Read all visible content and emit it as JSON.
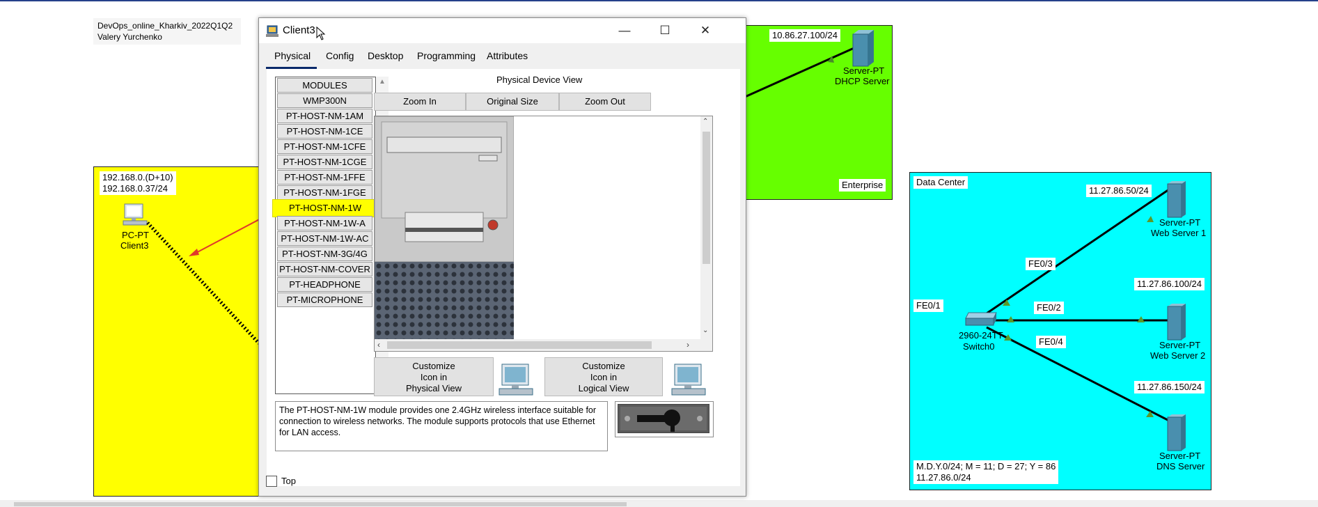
{
  "canvas": {
    "header_note": [
      "DevOps_online_Kharkiv_2022Q1Q2",
      "Valery Yurchenko"
    ],
    "yellow_zone": {
      "color": "#ffff00",
      "networks": [
        "192.168.0.(D+10)",
        "192.168.0.37/24"
      ],
      "device_type": "PC-PT",
      "device_name": "Client3"
    },
    "green_zone": {
      "color": "#66ff00",
      "ip": "10.86.27.100/24",
      "device_type": "Server-PT",
      "device_name": "DHCP Server",
      "zone_label": "Enterprise"
    },
    "cyan_zone": {
      "color": "#00ffff",
      "label": "Data Center",
      "port_fe01": "FE0/1",
      "ports": [
        "FE0/3",
        "FE0/2",
        "FE0/4"
      ],
      "switch_model": "2960-24TT",
      "switch_name": "Switch0",
      "servers": [
        {
          "ip": "11.27.86.50/24",
          "type": "Server-PT",
          "name": "Web Server 1"
        },
        {
          "ip": "11.27.86.100/24",
          "type": "Server-PT",
          "name": "Web Server 2"
        },
        {
          "ip": "11.27.86.150/24",
          "type": "Server-PT",
          "name": "DNS Server"
        }
      ],
      "formula": "M.D.Y.0/24; M = 11; D = 27; Y = 86",
      "subnet": "11.27.86.0/24"
    }
  },
  "window": {
    "title": "Client3",
    "controls": {
      "minimize": "—",
      "maximize": "☐",
      "close": "✕"
    },
    "tabs": [
      "Physical",
      "Config",
      "Desktop",
      "Programming",
      "Attributes"
    ],
    "active_tab": "Physical",
    "modules": [
      "MODULES",
      "WMP300N",
      "PT-HOST-NM-1AM",
      "PT-HOST-NM-1CE",
      "PT-HOST-NM-1CFE",
      "PT-HOST-NM-1CGE",
      "PT-HOST-NM-1FFE",
      "PT-HOST-NM-1FGE",
      "PT-HOST-NM-1W",
      "PT-HOST-NM-1W-A",
      "PT-HOST-NM-1W-AC",
      "PT-HOST-NM-3G/4G",
      "PT-HOST-NM-COVER",
      "PT-HEADPHONE",
      "PT-MICROPHONE"
    ],
    "selected_module": "PT-HOST-NM-1W",
    "physical_view_title": "Physical Device View",
    "zoom_in": "Zoom In",
    "original_size": "Original Size",
    "zoom_out": "Zoom Out",
    "customize_physical": [
      "Customize",
      "Icon in",
      "Physical View"
    ],
    "customize_logical": [
      "Customize",
      "Icon in",
      "Logical View"
    ],
    "description": "The PT-HOST-NM-1W module provides one 2.4GHz wireless interface suitable for connection to wireless networks. The module supports protocols that use Ethernet for LAN access.",
    "top_label": "Top",
    "top_checked": false
  }
}
